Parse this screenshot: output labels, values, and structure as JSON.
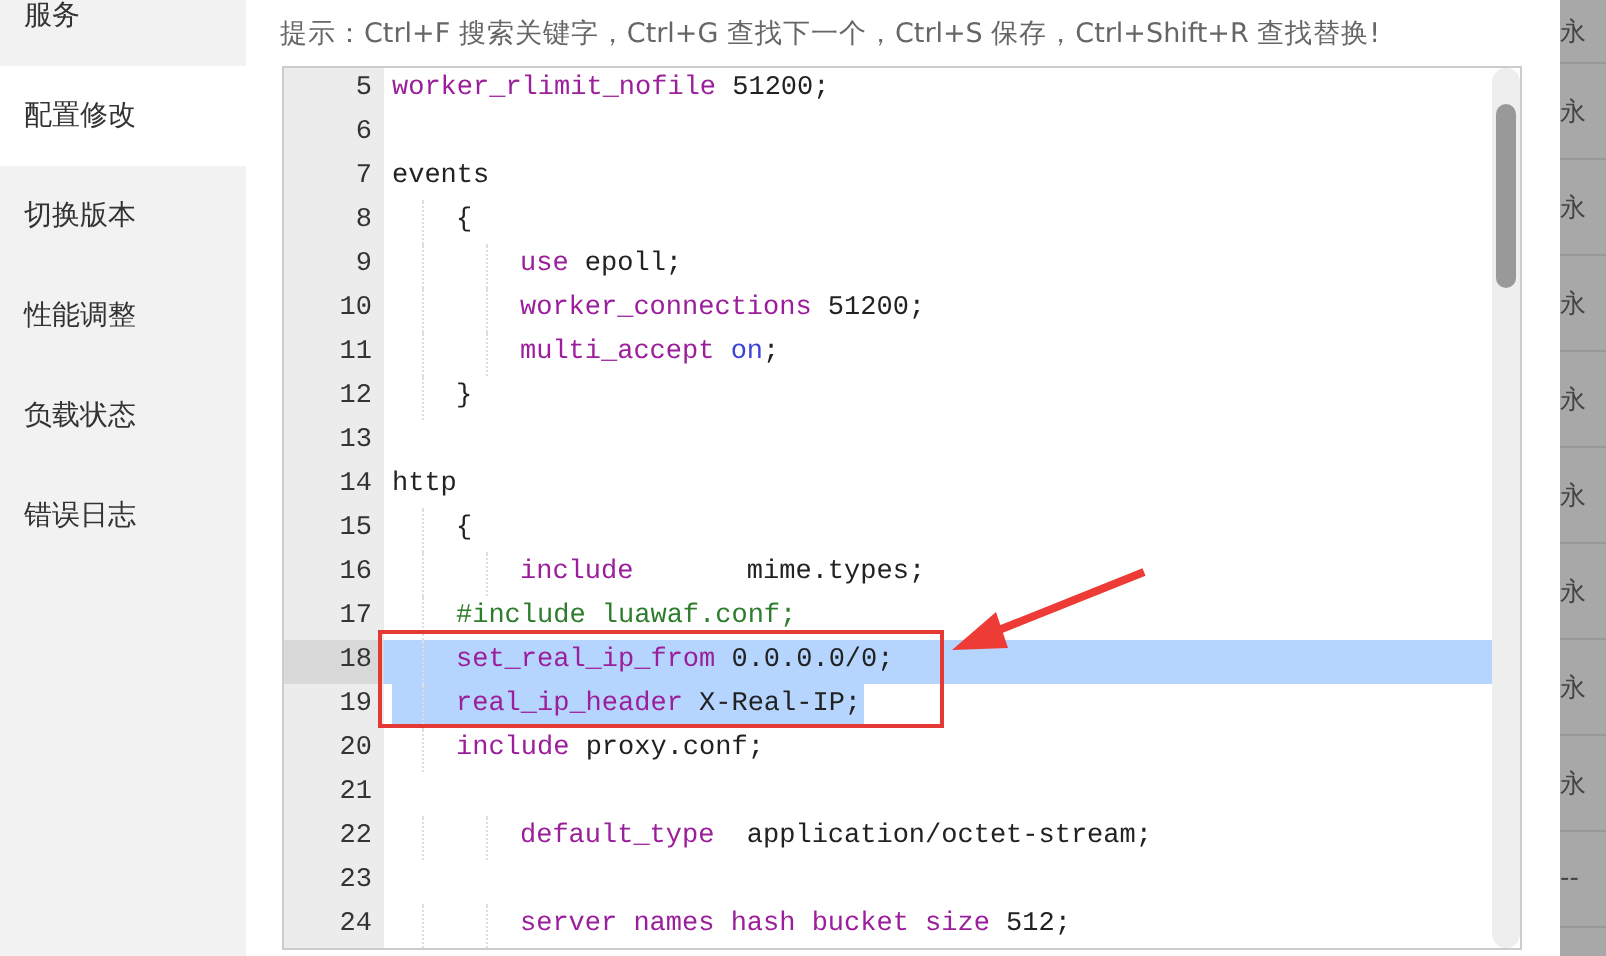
{
  "sidebar": {
    "items": [
      {
        "label": "服务",
        "selected": false
      },
      {
        "label": "配置修改",
        "selected": true
      },
      {
        "label": "切换版本",
        "selected": false
      },
      {
        "label": "性能调整",
        "selected": false
      },
      {
        "label": "负载状态",
        "selected": false
      },
      {
        "label": "错误日志",
        "selected": false
      }
    ]
  },
  "hint": "提示：Ctrl+F 搜索关键字，Ctrl+G 查找下一个，Ctrl+S 保存，Ctrl+Shift+R 查找替换!",
  "editor": {
    "lines": [
      {
        "number": "5",
        "active": false,
        "selected": false,
        "tokens": [
          {
            "kind": "keyword",
            "text": "worker_rlimit_nofile"
          },
          {
            "kind": "plain",
            "text": " 51200;"
          }
        ]
      },
      {
        "number": "6",
        "active": false,
        "selected": false
      },
      {
        "number": "7",
        "active": false,
        "selected": false,
        "tokens": [
          {
            "kind": "plain",
            "text": "events"
          }
        ],
        "children": [
          {
            "number": "8",
            "active": false,
            "selected": false,
            "tokens": [
              {
                "kind": "plain",
                "text": "{"
              }
            ],
            "children": [
              {
                "number": "9",
                "active": false,
                "selected": false,
                "tokens": [
                  {
                    "kind": "keyword",
                    "text": "use"
                  },
                  {
                    "kind": "plain",
                    "text": " epoll;"
                  }
                ]
              },
              {
                "number": "10",
                "active": false,
                "selected": false,
                "tokens": [
                  {
                    "kind": "keyword",
                    "text": "worker_connections"
                  },
                  {
                    "kind": "plain",
                    "text": " 51200;"
                  }
                ]
              },
              {
                "number": "11",
                "active": false,
                "selected": false,
                "tokens": [
                  {
                    "kind": "keyword",
                    "text": "multi_accept "
                  },
                  {
                    "kind": "atom",
                    "text": "on"
                  },
                  {
                    "kind": "plain",
                    "text": ";"
                  }
                ]
              }
            ]
          },
          {
            "number": "12",
            "active": false,
            "selected": false,
            "tokens": [
              {
                "kind": "plain",
                "text": "}"
              }
            ]
          }
        ]
      },
      {
        "number": "13",
        "active": false,
        "selected": false
      },
      {
        "number": "14",
        "active": false,
        "selected": false,
        "tokens": [
          {
            "kind": "plain",
            "text": "http"
          }
        ],
        "children": [
          {
            "number": "15",
            "active": false,
            "selected": false,
            "tokens": [
              {
                "kind": "plain",
                "text": "{"
              }
            ],
            "children": [
              {
                "number": "16",
                "active": false,
                "selected": false,
                "tokens": [
                  {
                    "kind": "keyword",
                    "text": "include"
                  },
                  {
                    "kind": "plain",
                    "text": "       mime.types;"
                  }
                ]
              }
            ]
          },
          {
            "number": "17",
            "active": false,
            "selected": false,
            "tokens": [
              {
                "kind": "comment",
                "text": "#include luawaf.conf;"
              }
            ]
          },
          {
            "number": "18",
            "active": true,
            "selected": true,
            "tokens": [
              {
                "kind": "keyword",
                "text": "set_real_ip_from"
              },
              {
                "kind": "plain",
                "text": " 0.0.0.0/0;"
              }
            ]
          },
          {
            "number": "19",
            "active": false,
            "selected": true,
            "tokens": [
              {
                "kind": "keyword",
                "text": "real_ip_header"
              },
              {
                "kind": "plain",
                "text": " X-Real-IP;"
              }
            ]
          },
          {
            "number": "20",
            "active": false,
            "selected": false,
            "tokens": [
              {
                "kind": "keyword",
                "text": "include"
              },
              {
                "kind": "plain",
                "text": " proxy.conf;"
              }
            ]
          },
          {
            "number": "21",
            "active": false,
            "selected": false,
            "children": [
              {
                "number": "22",
                "active": false,
                "selected": false,
                "tokens": [
                  {
                    "kind": "keyword",
                    "text": "default_type"
                  },
                  {
                    "kind": "plain",
                    "text": "  application/octet-stream;"
                  }
                ]
              },
              {
                "number": "23",
                "active": false,
                "selected": false
              },
              {
                "number": "24",
                "active": false,
                "selected": false,
                "tokens": [
                  {
                    "kind": "keyword",
                    "text": "server names hash bucket size"
                  },
                  {
                    "kind": "plain",
                    "text": " 512;"
                  }
                ]
              }
            ]
          }
        ]
      }
    ]
  },
  "side_column": {
    "cells": [
      "永",
      "永",
      "永",
      "永",
      "永",
      "永",
      "永",
      "永",
      "永",
      "--"
    ]
  }
}
